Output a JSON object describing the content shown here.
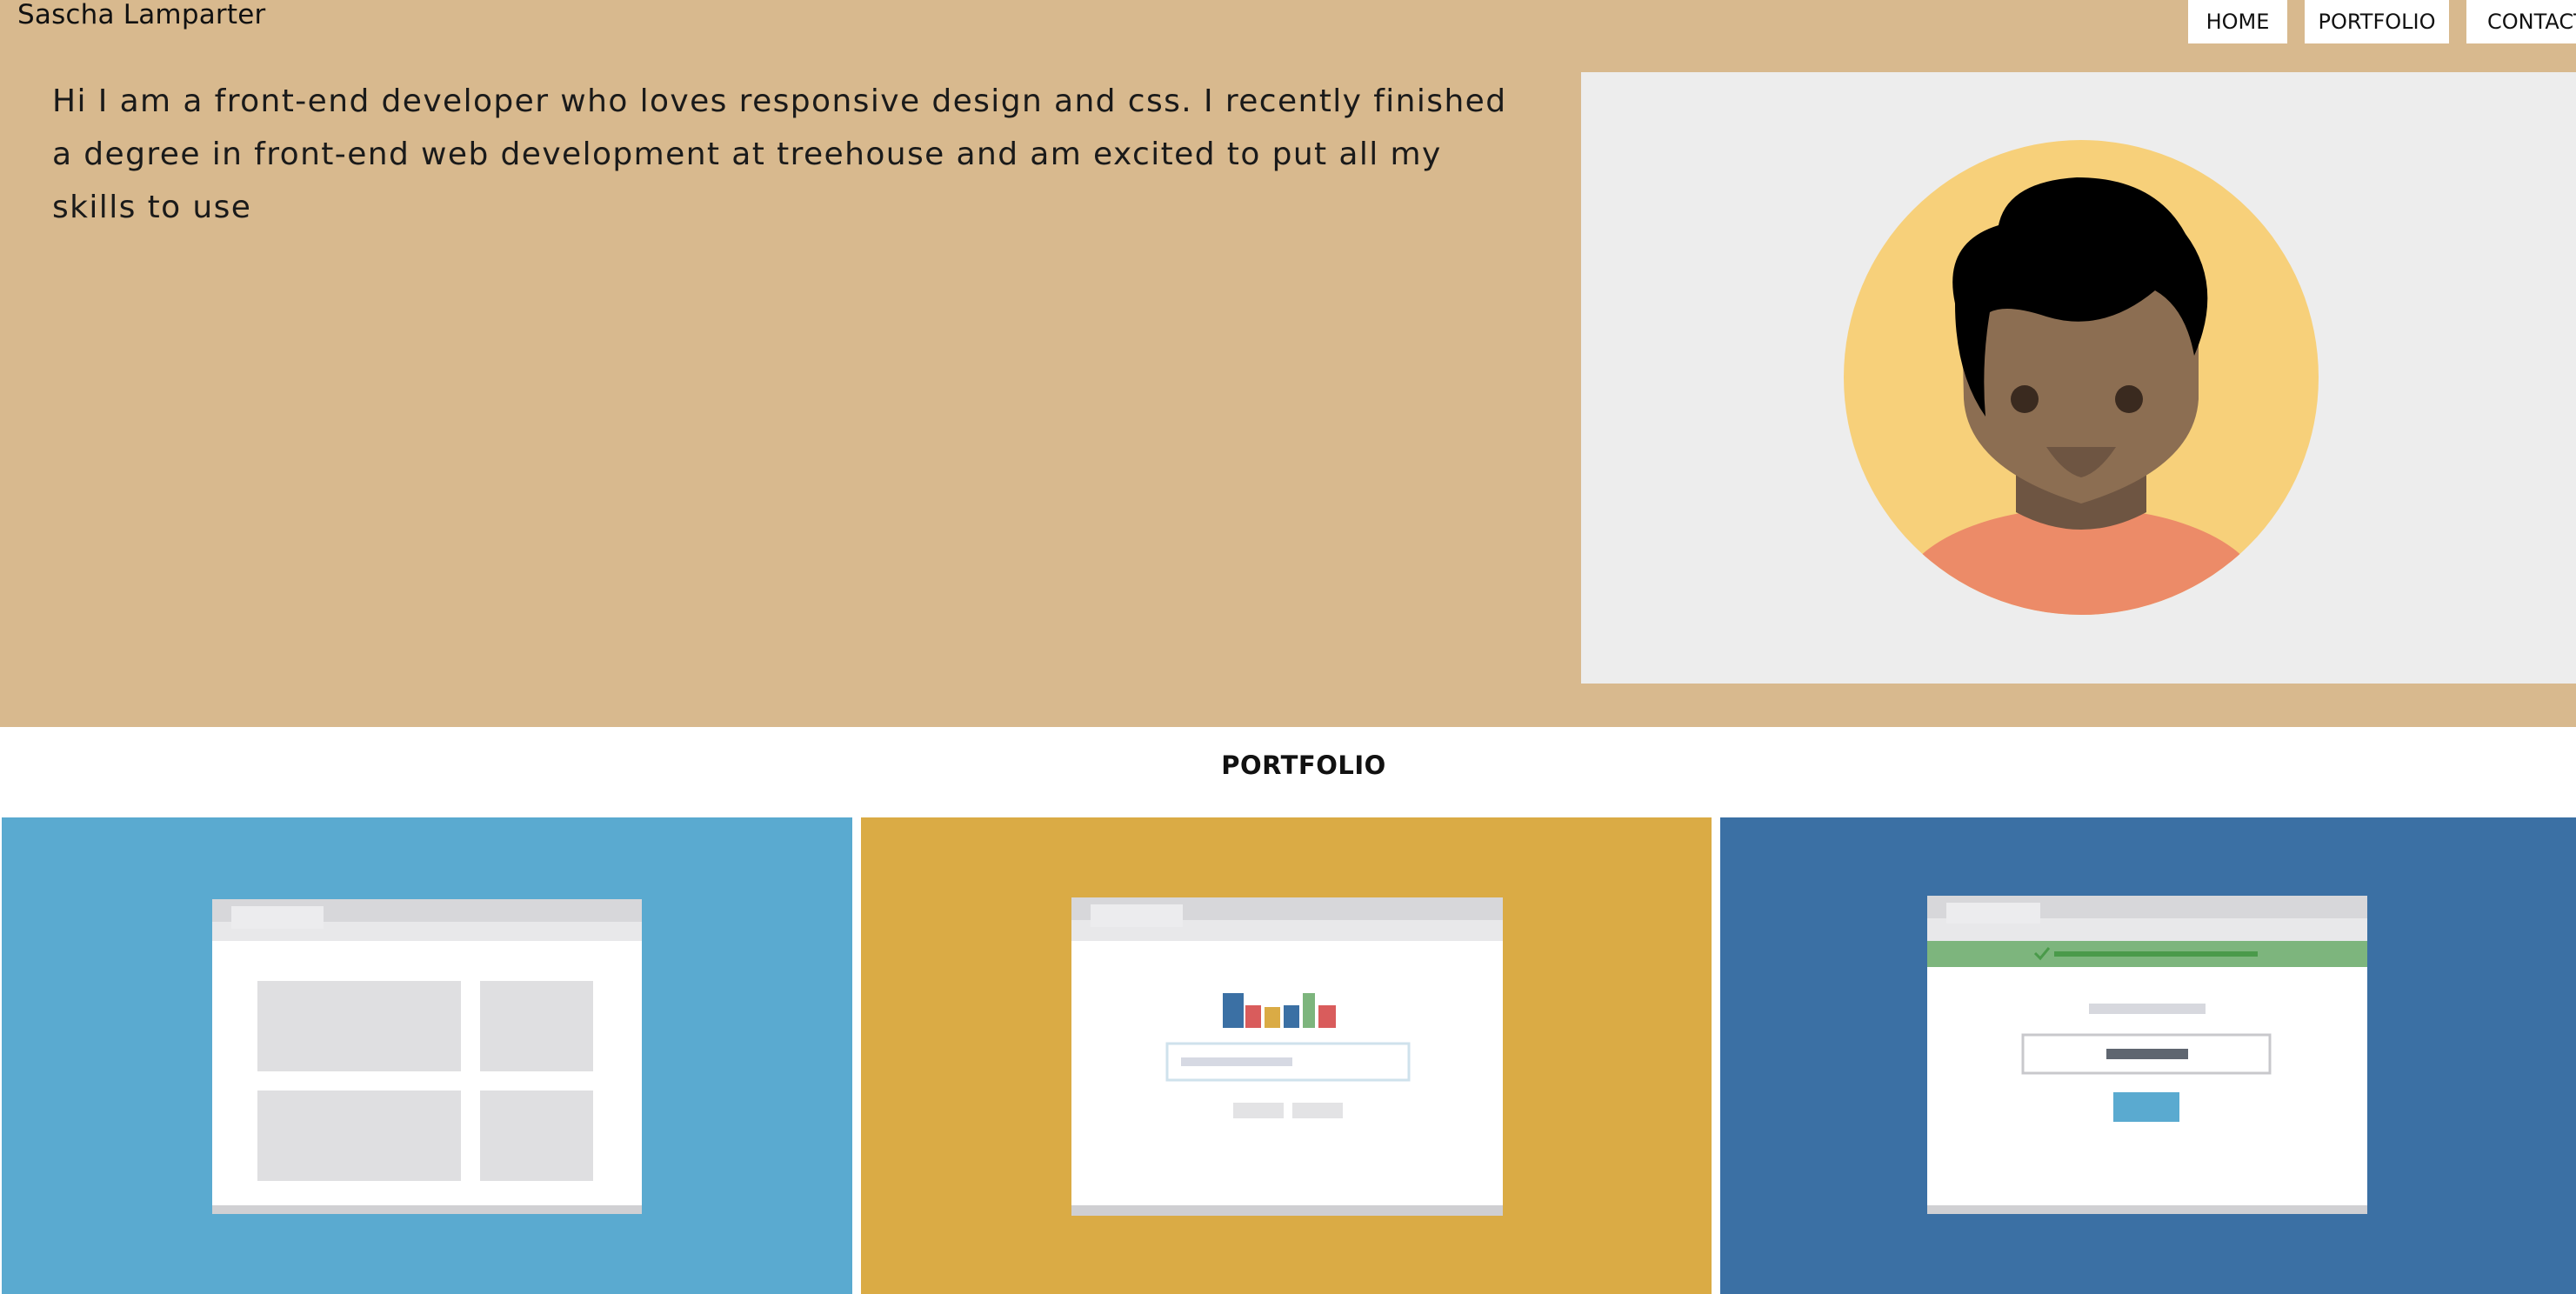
{
  "header": {
    "site_name": "Sascha Lamparter",
    "nav": [
      {
        "label": "HOME"
      },
      {
        "label": "PORTFOLIO"
      },
      {
        "label": "CONTACT"
      }
    ]
  },
  "hero": {
    "intro": "Hi I am a front-end developer who loves responsive design and css. I recently finished a degree in front-end web development at treehouse and am excited to put all my skills to use"
  },
  "portfolio": {
    "heading": "PORTFOLIO",
    "projects": [
      {
        "icon": "layout-grid-icon",
        "color": "#5aaad0"
      },
      {
        "icon": "dashboard-chart-icon",
        "color": "#daab45"
      },
      {
        "icon": "login-form-icon",
        "color": "#3b70a4"
      }
    ]
  },
  "colors": {
    "hero_background": "#d8b98e",
    "avatar_panel": "#ededed",
    "avatar_circle": "#f7d07a",
    "skin": "#8c6e52",
    "hair": "#000000",
    "shirt": "#ec8b68"
  }
}
